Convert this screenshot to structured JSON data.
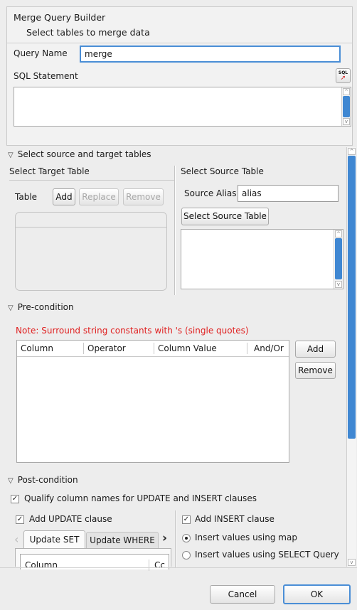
{
  "header": {
    "title": "Merge Query Builder",
    "subtitle": "Select tables to merge data"
  },
  "query": {
    "name_label": "Query Name",
    "name_value": "merge",
    "sql_label": "SQL Statement",
    "sql_icon_text": "SQL"
  },
  "tables_section": {
    "title": "Select source and target tables",
    "target": {
      "label": "Select Target Table",
      "table_label": "Table",
      "add": "Add",
      "replace": "Replace",
      "remove": "Remove"
    },
    "source": {
      "label": "Select Source Table",
      "alias_label": "Source Alias",
      "alias_value": "alias",
      "select_button": "Select Source Table"
    }
  },
  "precondition": {
    "title": "Pre-condition",
    "note": "Note: Surround string constants with 's (single quotes)",
    "note_color": "#e02020",
    "columns": [
      "Column",
      "Operator",
      "Column Value",
      "And/Or"
    ],
    "add": "Add",
    "remove": "Remove"
  },
  "postcondition": {
    "title": "Post-condition",
    "qualify_label": "Qualify column names for UPDATE and INSERT clauses",
    "qualify_checked": true,
    "update_label": "Add UPDATE clause",
    "update_checked": true,
    "tabs": [
      "Update SET",
      "Update WHERE"
    ],
    "column_header": "Column",
    "column_header_2": "Cc",
    "insert_label": "Add INSERT clause",
    "insert_checked": true,
    "radio_map": "Insert values using map",
    "radio_select": "Insert values using SELECT Query",
    "radio_selected": "map"
  },
  "footer": {
    "cancel": "Cancel",
    "ok": "OK"
  },
  "colors": {
    "accent": "#3f87d2",
    "background": "#ededed"
  }
}
